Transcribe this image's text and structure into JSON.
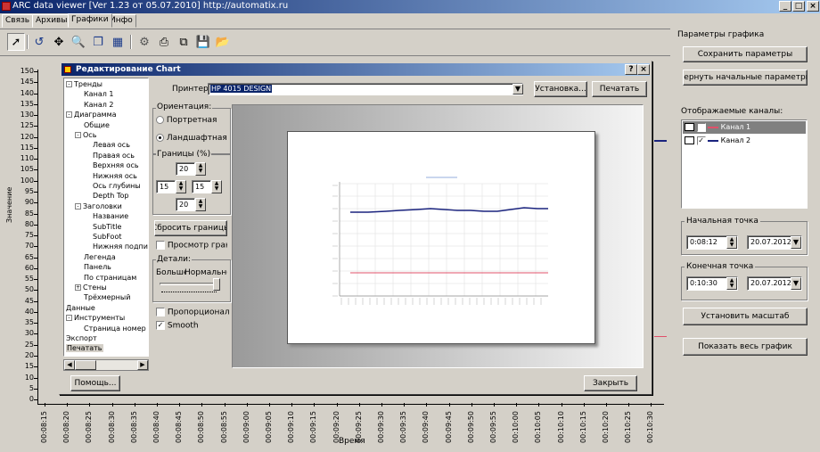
{
  "window": {
    "title": "ARC data viewer [Ver 1.23 от 05.07.2010]   http://automatix.ru",
    "min": "_",
    "max": "□",
    "close": "×"
  },
  "tabs": [
    {
      "label": "Связь"
    },
    {
      "label": "Архивы"
    },
    {
      "label": "Графики"
    },
    {
      "label": "Инфо"
    }
  ],
  "active_tab": "Графики",
  "toolbar": {
    "icons": [
      "pointer-icon",
      "undo-icon",
      "move-icon",
      "zoom-icon",
      "copy-icon",
      "copy-image-icon",
      "edit-icon",
      "print-icon",
      "copy-page-icon",
      "save-icon",
      "open-icon"
    ]
  },
  "chart": {
    "ylabel": "Значение",
    "xlabel": "Время",
    "yticks": [
      "150",
      "145",
      "140",
      "135",
      "130",
      "125",
      "120",
      "115",
      "110",
      "105",
      "100",
      "95",
      "90",
      "85",
      "80",
      "75",
      "70",
      "65",
      "60",
      "55",
      "50",
      "45",
      "40",
      "35",
      "30",
      "25",
      "20",
      "15",
      "10",
      "5",
      "0"
    ],
    "xticks": [
      "00:08:15",
      "00:08:20",
      "00:08:25",
      "00:08:30",
      "00:08:35",
      "00:08:40",
      "00:08:45",
      "00:08:50",
      "00:08:55",
      "00:09:00",
      "00:09:05",
      "00:09:10",
      "00:09:15",
      "00:09:20",
      "00:09:25",
      "00:09:30",
      "00:09:35",
      "00:09:40",
      "00:09:45",
      "00:09:50",
      "00:09:55",
      "00:10:00",
      "00:10:05",
      "00:10:10",
      "00:10:15",
      "00:10:20",
      "00:10:25",
      "00:10:30"
    ]
  },
  "right_panel": {
    "group_title": "Параметры графика",
    "save_label": "Сохранить параметры",
    "reset_label": "Вернуть начальные параметры",
    "channels_label": "Отображаемые каналы:",
    "channels": [
      {
        "name": "Канал 1",
        "color": "#e0506a",
        "checked": true
      },
      {
        "name": "Канал 2",
        "color": "#1a237e",
        "checked": true
      }
    ],
    "start_label": "Начальная точка",
    "start_time": "0:08:12",
    "start_date": "20.07.2012",
    "end_label": "Конечная точка",
    "end_time": "0:10:30",
    "end_date": "20.07.2012",
    "set_scale_label": "Установить масштаб",
    "show_all_label": "Показать весь график"
  },
  "dialog": {
    "title": "Редактирование Chart",
    "help_btn": "?",
    "close_btn": "×",
    "tree": [
      {
        "label": "Тренды",
        "level": 0,
        "exp": "-"
      },
      {
        "label": "Канал 1",
        "level": 2
      },
      {
        "label": "Канал 2",
        "level": 2
      },
      {
        "label": "Диаграмма",
        "level": 0,
        "exp": "-"
      },
      {
        "label": "Общие",
        "level": 2
      },
      {
        "label": "Ось",
        "level": 1,
        "exp": "-"
      },
      {
        "label": "Левая ось",
        "level": 3
      },
      {
        "label": "Правая ось",
        "level": 3
      },
      {
        "label": "Верхняя ось",
        "level": 3
      },
      {
        "label": "Нижняя ось",
        "level": 3
      },
      {
        "label": "Ось глубины",
        "level": 3
      },
      {
        "label": "Depth Top",
        "level": 3
      },
      {
        "label": "Заголовки",
        "level": 1,
        "exp": "-"
      },
      {
        "label": "Название",
        "level": 3
      },
      {
        "label": "SubTitle",
        "level": 3
      },
      {
        "label": "SubFoot",
        "level": 3
      },
      {
        "label": "Нижняя подпись",
        "level": 3
      },
      {
        "label": "Легенда",
        "level": 2
      },
      {
        "label": "Панель",
        "level": 2
      },
      {
        "label": "По страницам",
        "level": 2
      },
      {
        "label": "Стены",
        "level": 1,
        "exp": "+"
      },
      {
        "label": "Трёхмерный",
        "level": 2
      },
      {
        "label": "Данные",
        "level": 0
      },
      {
        "label": "Инструменты",
        "level": 0,
        "exp": "-"
      },
      {
        "label": "Страница номер",
        "level": 2
      },
      {
        "label": "Экспорт",
        "level": 0
      },
      {
        "label": "Печатать",
        "level": 0,
        "sel": true
      }
    ],
    "printer_label": "Принтер:",
    "printer_value": "HP 4015 DESIGN",
    "setup_btn": "Установка...",
    "print_btn": "Печатать",
    "orientation_label": "Ориентация:",
    "portrait": "Портретная",
    "landscape": "Ландшафтная",
    "margins_label": "Границы (%)",
    "margin_top": "20",
    "margin_left": "15",
    "margin_right": "15",
    "margin_bottom": "20",
    "reset_margins_btn": "Сбросить границы",
    "view_margins": "Просмотр границ",
    "details_label": "Детали:",
    "detail_more": "Больше",
    "detail_normal": "Нормально",
    "proportional": "Пропорционал",
    "smooth": "Smooth",
    "help_btn_label": "Помощь...",
    "close_dialog_btn": "Закрыть"
  },
  "colors": {
    "ch1": "#e0506a",
    "ch2": "#1a237e",
    "title_blue": "#0a246a"
  }
}
